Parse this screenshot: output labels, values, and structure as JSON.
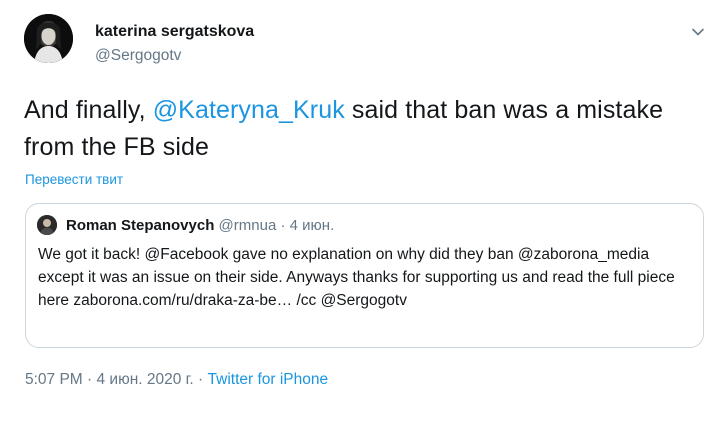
{
  "author": {
    "name": "katerina sergatskova",
    "handle": "@Sergogotv"
  },
  "tweet": {
    "text_before": "And finally, ",
    "mention": "@Kateryna_Kruk",
    "text_after": " said that ban was a mistake from the FB side"
  },
  "translate_label": "Перевести твит",
  "quote": {
    "name": "Roman Stepanovych",
    "handle": "@rmnua",
    "separator": " · ",
    "date": "4 июн.",
    "text": "We got it back! @Facebook gave no explanation on why did they ban @zaborona_media except it was an issue on their side. Anyways thanks for supporting us and read the full piece here zaborona.com/ru/draka-za-be… /cc @Sergogotv"
  },
  "footer": {
    "timestamp": "5:07 PM · 4 июн. 2020 г. · ",
    "source": "Twitter for iPhone"
  },
  "icons": {
    "caret": "chevron-down-icon"
  },
  "colors": {
    "link": "#1b95e0",
    "secondary_text": "#657786",
    "primary_text": "#14171a",
    "border": "#ccd6dd"
  }
}
